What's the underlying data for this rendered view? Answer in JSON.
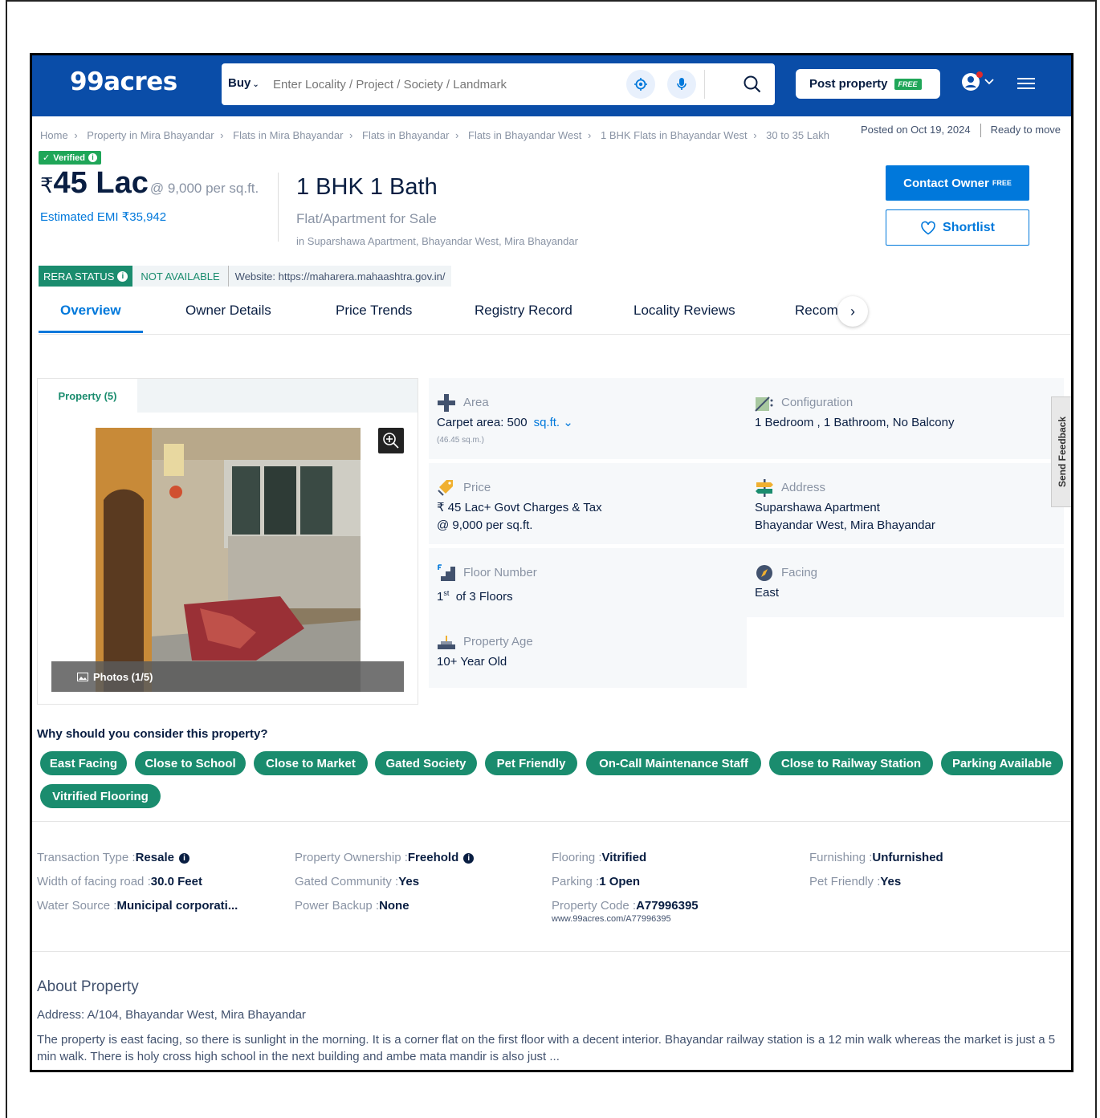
{
  "header": {
    "logo": "99acres",
    "search_mode": "Buy",
    "search_placeholder": "Enter Locality / Project / Society / Landmark",
    "post_property": "Post property",
    "free_tag": "FREE"
  },
  "breadcrumbs": [
    "Home",
    "Property in Mira Bhayandar",
    "Flats in Mira Bhayandar",
    "Flats in Bhayandar",
    "Flats in Bhayandar West",
    "1 BHK Flats in Bhayandar West",
    "30 to 35 Lakh"
  ],
  "breadcrumb_sep": "›",
  "posted": "Posted on Oct 19, 2024",
  "status": "Ready to move",
  "listing": {
    "verified": "Verified",
    "currency": "₹",
    "price": "45 Lac",
    "per_sqft": "@ 9,000 per sq.ft.",
    "emi": "Estimated EMI ₹35,942",
    "config": "1 BHK 1 Bath",
    "type": "Flat/Apartment for Sale",
    "location": "in Suparshawa Apartment, Bhayandar West, Mira Bhayandar",
    "contact_btn": "Contact Owner",
    "contact_free": "FREE",
    "shortlist_btn": "Shortlist"
  },
  "rera": {
    "label": "RERA STATUS",
    "value": "NOT AVAILABLE",
    "website": "Website: https://maharera.mahaashtra.gov.in/"
  },
  "tabs": [
    "Overview",
    "Owner Details",
    "Price Trends",
    "Registry Record",
    "Locality Reviews",
    "Recom..."
  ],
  "photo": {
    "tab": "Property (5)",
    "counter": "Photos (1/5)"
  },
  "details": {
    "area": {
      "label": "Area",
      "value": "Carpet area: 500",
      "unit": "sq.ft.",
      "sub": "(46.45 sq.m.)"
    },
    "configuration": {
      "label": "Configuration",
      "value": "1 Bedroom , 1 Bathroom, No Balcony"
    },
    "price": {
      "label": "Price",
      "value1": "₹ 45 Lac+ Govt Charges & Tax",
      "value2": "@ 9,000 per sq.ft."
    },
    "address": {
      "label": "Address",
      "value1": "Suparshawa Apartment",
      "value2": "Bhayandar West, Mira Bhayandar"
    },
    "floor": {
      "label": "Floor Number",
      "floor_no": "1",
      "suffix": "st",
      "value": "of 3 Floors"
    },
    "facing": {
      "label": "Facing",
      "value": "East"
    },
    "age": {
      "label": "Property Age",
      "value": "10+ Year Old"
    }
  },
  "feedback": "Send Feedback",
  "why_title": "Why should you consider this property?",
  "reasons": [
    "East Facing",
    "Close to School",
    "Close to Market",
    "Gated Society",
    "Pet Friendly",
    "On-Call Maintenance Staff",
    "Close to Railway Station",
    "Parking Available",
    "Vitrified Flooring"
  ],
  "specs": {
    "transaction": {
      "k": "Transaction Type :",
      "v": "Resale"
    },
    "ownership": {
      "k": "Property Ownership :",
      "v": "Freehold"
    },
    "flooring": {
      "k": "Flooring :",
      "v": "Vitrified"
    },
    "furnishing": {
      "k": "Furnishing :",
      "v": "Unfurnished"
    },
    "road": {
      "k": "Width of facing road :",
      "v": "30.0 Feet"
    },
    "gated": {
      "k": "Gated Community :",
      "v": "Yes"
    },
    "parking": {
      "k": "Parking :",
      "v": "1 Open"
    },
    "pet": {
      "k": "Pet Friendly :",
      "v": "Yes"
    },
    "water": {
      "k": "Water Source :",
      "v": "Municipal corporati..."
    },
    "backup": {
      "k": "Power Backup :",
      "v": "None"
    },
    "code": {
      "k": "Property Code :",
      "v": "A77996395"
    },
    "code_url": "www.99acres.com/A77996395"
  },
  "about": {
    "title": "About Property",
    "address": "Address: A/104, Bhayandar West, Mira Bhayandar",
    "description": "The property is east facing, so there is sunlight in the morning. It is a corner flat on the first floor with a decent interior. Bhayandar railway station is a 12 min walk whereas the market is just a 5 min walk. There is holy cross high school in the next building and ambe mata mandir is also just ..."
  },
  "colors": {
    "brand": "#0A4DA8",
    "accent": "#0078DB",
    "green": "#1A8C6E"
  }
}
